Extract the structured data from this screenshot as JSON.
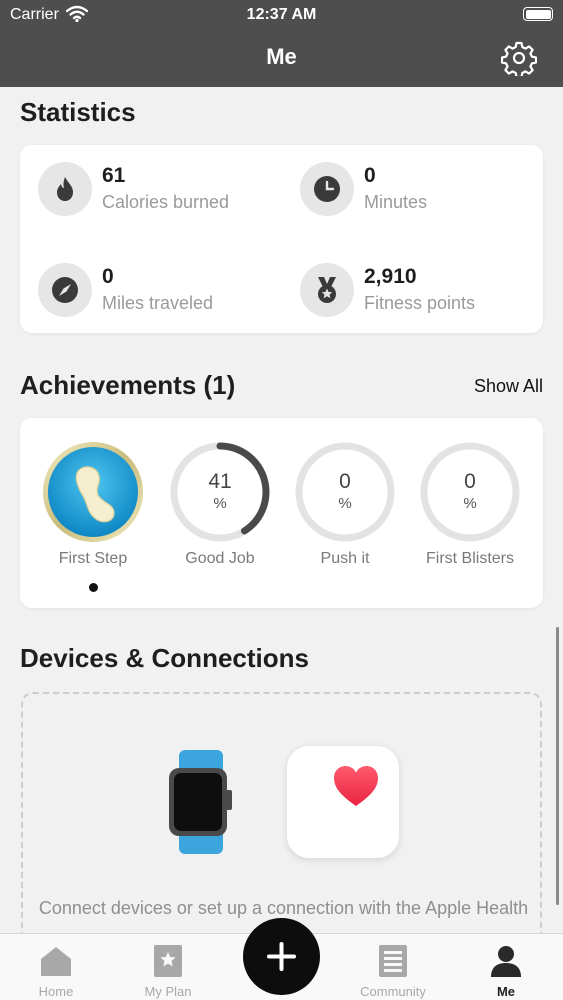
{
  "status_bar": {
    "carrier": "Carrier",
    "time": "12:37 AM"
  },
  "nav": {
    "title": "Me"
  },
  "statistics": {
    "title": "Statistics",
    "items": [
      {
        "value": "61",
        "label": "Calories burned",
        "icon": "flame-icon"
      },
      {
        "value": "0",
        "label": "Minutes",
        "icon": "clock-icon"
      },
      {
        "value": "0",
        "label": "Miles traveled",
        "icon": "compass-icon"
      },
      {
        "value": "2,910",
        "label": "Fitness points",
        "icon": "medal-icon"
      }
    ]
  },
  "achievements": {
    "title": "Achievements (1)",
    "show_all": "Show All",
    "items": [
      {
        "name": "First Step",
        "earned": true,
        "icon": "footprint-badge-icon"
      },
      {
        "name": "Good Job",
        "percent": 41,
        "percent_text": "41",
        "percent_sign": "%"
      },
      {
        "name": "Push it",
        "percent": 0,
        "percent_text": "0",
        "percent_sign": "%"
      },
      {
        "name": "First Blisters",
        "percent": 0,
        "percent_text": "0",
        "percent_sign": "%"
      }
    ]
  },
  "devices": {
    "title": "Devices & Connections",
    "connect_text": "Connect devices or set up a connection with the Apple Health app"
  },
  "tabs": [
    {
      "label": "Home",
      "icon": "home-icon"
    },
    {
      "label": "My Plan",
      "icon": "star-card-icon"
    },
    {
      "label": "Community",
      "icon": "document-icon"
    },
    {
      "label": "Me",
      "icon": "person-icon",
      "active": true
    }
  ],
  "fab": {
    "icon": "plus-icon"
  },
  "colors": {
    "header": "#4e4e4e",
    "ring_track": "#e3e3e3",
    "ring_progress": "#4a4a4a",
    "heart": "#f0354f",
    "watch_band": "#3da5dd"
  }
}
